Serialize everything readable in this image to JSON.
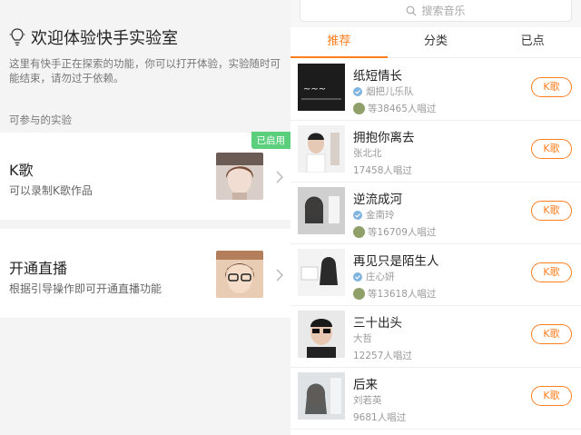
{
  "lab": {
    "title": "欢迎体验快手实验室",
    "description": "这里有快手正在探索的功能，你可以打开体验，实验随时可能结束，请勿过于依赖。",
    "section_label": "可参与的实验",
    "experiments": [
      {
        "title": "K歌",
        "subtitle": "可以录制K歌作品",
        "badge": "已启用"
      },
      {
        "title": "开通直播",
        "subtitle": "根据引导操作即可开通直播功能"
      }
    ]
  },
  "music": {
    "search_placeholder": "搜索音乐",
    "tabs": [
      "推荐",
      "分类",
      "已点"
    ],
    "songs": [
      {
        "title": "纸短情长",
        "artist": "烟把儿乐队",
        "count": "等38465人唱过",
        "button": "K歌"
      },
      {
        "title": "拥抱你离去",
        "artist": "张北北",
        "count": "17458人唱过",
        "button": "K歌"
      },
      {
        "title": "逆流成河",
        "artist": "金南玲",
        "count": "等16709人唱过",
        "button": "K歌"
      },
      {
        "title": "再见只是陌生人",
        "artist": "庄心妍",
        "count": "等13618人唱过",
        "button": "K歌"
      },
      {
        "title": "三十出头",
        "artist": "大哲",
        "count": "12257人唱过",
        "button": "K歌"
      },
      {
        "title": "后来",
        "artist": "刘若英",
        "count": "9681人唱过",
        "button": "K歌"
      }
    ]
  },
  "colors": {
    "accent": "#ff7e1e",
    "badge": "#5ccf7d",
    "verify": "#7fb3e0"
  }
}
